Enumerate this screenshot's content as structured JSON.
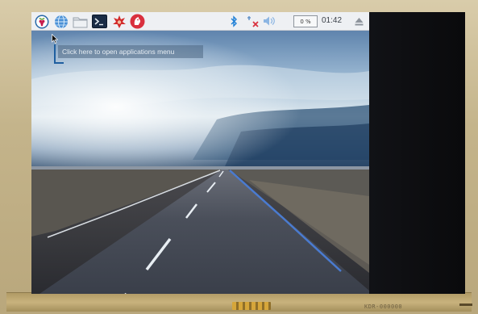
{
  "taskbar": {
    "launchers": [
      {
        "name": "raspberry-menu-icon"
      },
      {
        "name": "web-browser-icon"
      },
      {
        "name": "file-manager-icon"
      },
      {
        "name": "terminal-icon"
      },
      {
        "name": "mathematica-icon"
      },
      {
        "name": "wolfram-icon"
      }
    ],
    "tray": {
      "bluetooth_icon": "bluetooth-icon",
      "network_icon": "network-disconnected-icon",
      "volume_icon": "volume-icon",
      "cpu_usage": "0 %",
      "clock": "01:42",
      "eject_icon": "eject-icon"
    }
  },
  "tooltip": {
    "text": "Click here to open applications menu"
  },
  "device": {
    "serial_label": "KDR-000000"
  },
  "colors": {
    "menubar_bg": "#eef0f3",
    "raspberry_red": "#c51a4a",
    "bluetooth_blue": "#1e7fd6",
    "network_red": "#d9303e"
  }
}
